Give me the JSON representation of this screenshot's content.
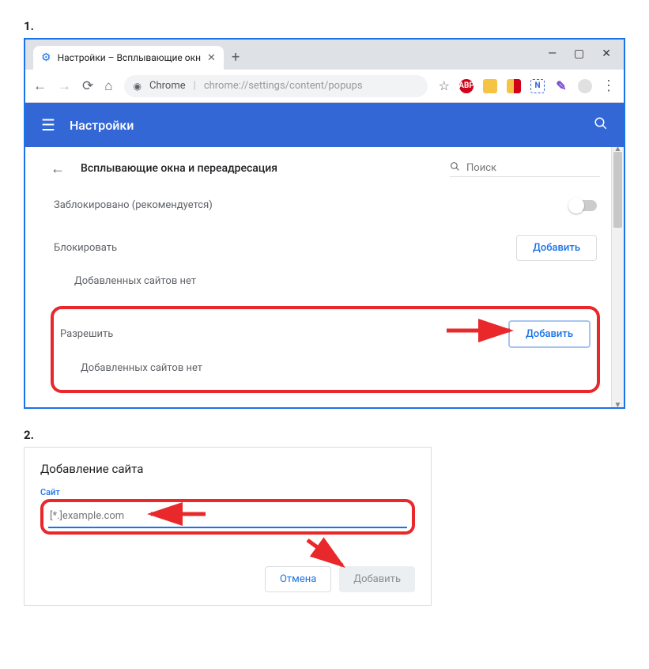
{
  "steps": {
    "one": "1.",
    "two": "2."
  },
  "tab": {
    "title": "Настройки – Всплывающие окн"
  },
  "omnibox": {
    "label": "Chrome",
    "path": "chrome://settings/content/popups"
  },
  "settings_bar": {
    "title": "Настройки"
  },
  "section": {
    "title": "Всплывающие окна и переадресация",
    "search_placeholder": "Поиск",
    "blocked_label": "Заблокировано (рекомендуется)",
    "block_list_label": "Блокировать",
    "allow_list_label": "Разрешить",
    "add_label": "Добавить",
    "empty_label": "Добавленных сайтов нет"
  },
  "dialog": {
    "title": "Добавление сайта",
    "field_label": "Сайт",
    "placeholder": "[*.]example.com",
    "cancel": "Отмена",
    "add": "Добавить"
  }
}
